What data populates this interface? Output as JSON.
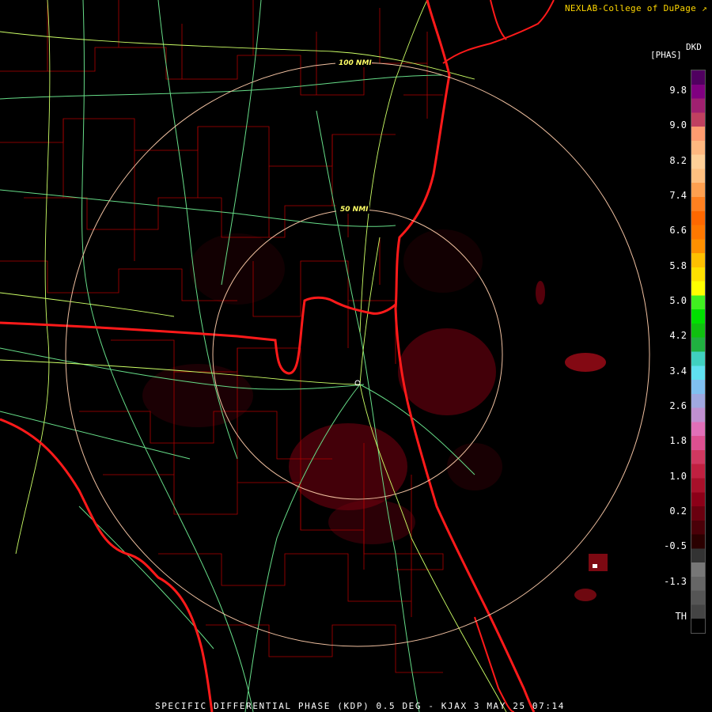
{
  "header": {
    "credit": "NEXLAB-College of DuPage",
    "credit_icon": "external-link-icon"
  },
  "legend": {
    "product": "DKD",
    "units": "[PHAS]",
    "ticks": [
      "9.8",
      "9.0",
      "8.2",
      "7.4",
      "6.6",
      "5.8",
      "5.0",
      "4.2",
      "3.4",
      "2.6",
      "1.8",
      "1.0",
      "0.2",
      "-0.5",
      "-1.3",
      "TH"
    ],
    "colors": [
      "#000000",
      "#444444",
      "#555555",
      "#666666",
      "#777777",
      "#333333",
      "#2a0000",
      "#4a0008",
      "#6a000f",
      "#8c0018",
      "#a8102a",
      "#c02040",
      "#d03860",
      "#dc5090",
      "#e070b8",
      "#c090d0",
      "#a0a8e0",
      "#80c0f0",
      "#60e0f0",
      "#40d0c0",
      "#20b040",
      "#10c010",
      "#00e000",
      "#40f020",
      "#ffff00",
      "#ffe000",
      "#ffc000",
      "#ff9000",
      "#ff7800",
      "#ff6800",
      "#ff8020",
      "#ffa050",
      "#ffc080",
      "#ffd098",
      "#ffb880",
      "#ff9c70",
      "#c04060",
      "#a02070",
      "#800080",
      "#500060"
    ]
  },
  "map": {
    "range_rings": [
      "50 NMI",
      "100 NMI"
    ],
    "colors": {
      "state_border": "#ff1a1a",
      "county_line": "#b00000",
      "highway": "#ccff66",
      "interstate": "#66dd88",
      "range_ring": "#f0c0a0",
      "echo": "#8a0010"
    }
  },
  "footer": {
    "title": "SPECIFIC DIFFERENTIAL PHASE (KDP) 0.5 DEG - KJAX 3 MAY 25 07:14"
  }
}
